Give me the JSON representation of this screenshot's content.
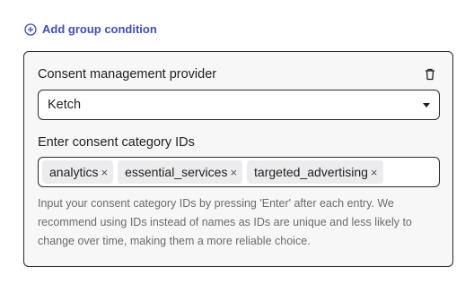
{
  "add_group": {
    "label": "Add group condition",
    "icon": "plus-circle-icon"
  },
  "provider": {
    "label": "Consent management provider",
    "selected": "Ketch",
    "delete_icon": "trash-icon"
  },
  "category_ids": {
    "label": "Enter consent category IDs",
    "tags": [
      "analytics",
      "essential_services",
      "targeted_advertising"
    ],
    "remove_glyph": "×",
    "hint": "Input your consent category IDs by pressing 'Enter' after each entry. We recommend using IDs instead of names as IDs are unique and less likely to change over time, making them a more reliable choice."
  },
  "colors": {
    "accent": "#3b4fc4",
    "panel_bg": "#f7f7f8",
    "tag_bg": "#ececee",
    "hint": "#6b6b70"
  }
}
